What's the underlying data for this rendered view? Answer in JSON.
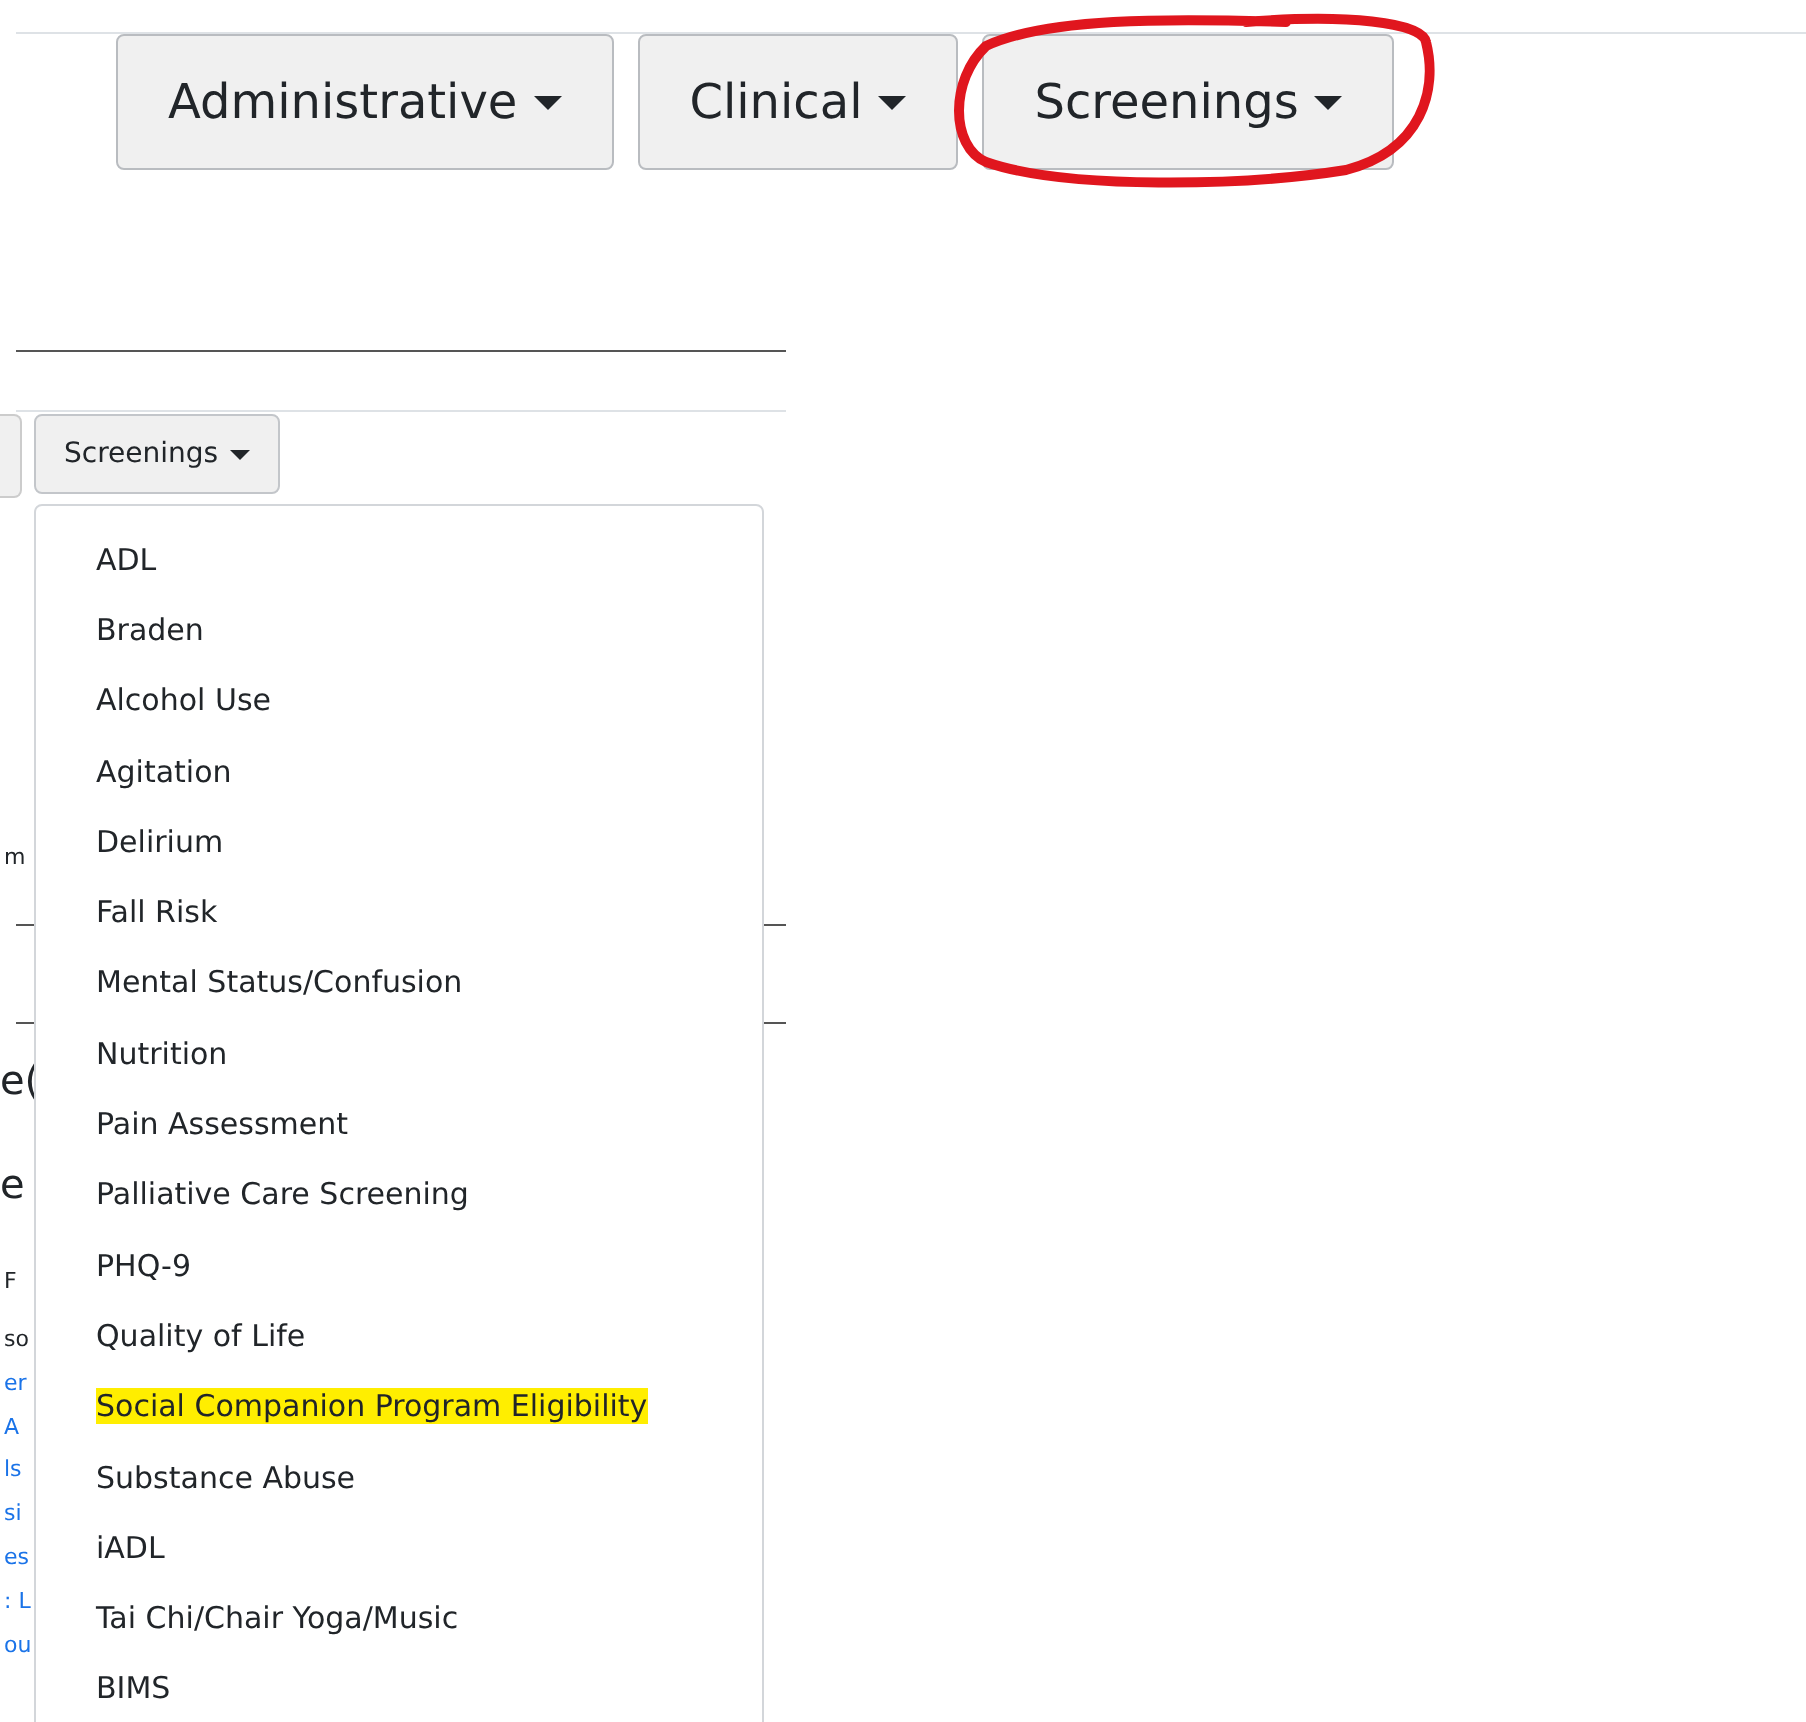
{
  "top_buttons": [
    {
      "label": "Administrative",
      "circled": false
    },
    {
      "label": "Clinical",
      "circled": false
    },
    {
      "label": "Screenings",
      "circled": true
    }
  ],
  "lower": {
    "button": {
      "label": "Screenings"
    },
    "left_fragments": [
      {
        "text": "m",
        "kind": "plain"
      },
      {
        "text": "e(",
        "kind": "heading"
      },
      {
        "text": "e",
        "kind": "heading"
      },
      {
        "text": "F",
        "kind": "plain"
      },
      {
        "text": "so",
        "kind": "plain"
      },
      {
        "text": "er",
        "kind": "link"
      },
      {
        "text": "A",
        "kind": "link"
      },
      {
        "text": "ls",
        "kind": "link"
      },
      {
        "text": "si",
        "kind": "link"
      },
      {
        "text": "es",
        "kind": "link"
      },
      {
        "text": ": L",
        "kind": "link"
      },
      {
        "text": "ou",
        "kind": "link"
      }
    ],
    "menu": [
      {
        "label": "ADL",
        "highlighted": false
      },
      {
        "label": "Braden",
        "highlighted": false
      },
      {
        "label": "Alcohol Use",
        "highlighted": false
      },
      {
        "label": "Agitation",
        "highlighted": false
      },
      {
        "label": "Delirium",
        "highlighted": false
      },
      {
        "label": "Fall Risk",
        "highlighted": false
      },
      {
        "label": "Mental Status/Confusion",
        "highlighted": false
      },
      {
        "label": "Nutrition",
        "highlighted": false
      },
      {
        "label": "Pain Assessment",
        "highlighted": false
      },
      {
        "label": "Palliative Care Screening",
        "highlighted": false
      },
      {
        "label": "PHQ-9",
        "highlighted": false
      },
      {
        "label": "Quality of Life",
        "highlighted": false
      },
      {
        "label": "Social Companion Program Eligibility",
        "highlighted": true
      },
      {
        "label": "Substance Abuse",
        "highlighted": false
      },
      {
        "label": "iADL",
        "highlighted": false
      },
      {
        "label": "Tai Chi/Chair Yoga/Music",
        "highlighted": false
      },
      {
        "label": "BIMS",
        "highlighted": false
      }
    ]
  }
}
